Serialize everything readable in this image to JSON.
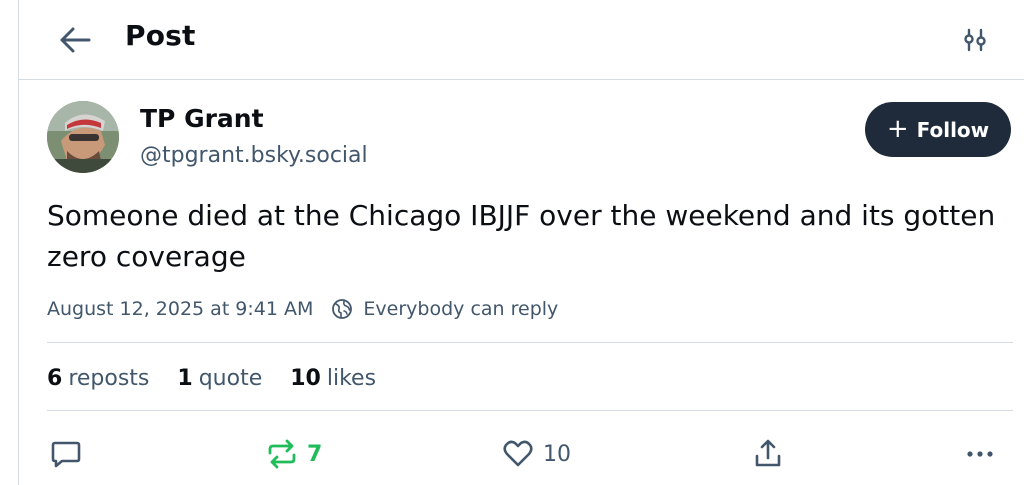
{
  "header": {
    "title": "Post"
  },
  "author": {
    "name": "TP Grant",
    "handle": "@tpgrant.bsky.social"
  },
  "follow_button": {
    "plus": "+",
    "label": "Follow"
  },
  "post": {
    "text": "Someone died at the Chicago IBJJF over the weekend and its gotten zero coverage",
    "timestamp": "August 12, 2025 at 9:41 AM",
    "reply_setting": "Everybody can reply"
  },
  "stats": {
    "reposts_count": "6",
    "reposts_label": "reposts",
    "quotes_count": "1",
    "quotes_label": "quote",
    "likes_count": "10",
    "likes_label": "likes"
  },
  "actions": {
    "repost_count": "7",
    "like_count": "10"
  },
  "colors": {
    "accent_dark": "#1f2b3a",
    "muted_text": "#42576c",
    "repost_active": "#20bc5a",
    "divider": "#d4dbe2"
  },
  "icons": {
    "back": "arrow-left-icon",
    "settings": "sliders-icon",
    "reply_setting": "globe-icon",
    "reply": "comment-icon",
    "repost": "repost-icon",
    "like": "heart-icon",
    "share": "share-icon",
    "more": "more-dots-icon"
  }
}
